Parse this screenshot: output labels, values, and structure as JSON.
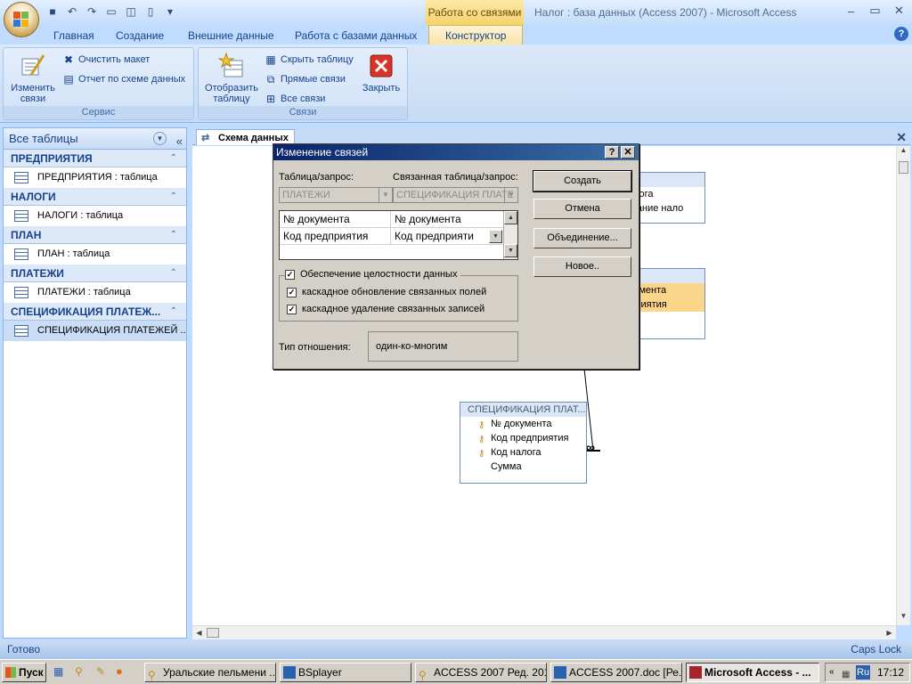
{
  "window": {
    "title": "Налог : база данных (Access 2007) - Microsoft Access",
    "context_tab_group": "Работа со связями"
  },
  "ribbon": {
    "tabs": [
      "Главная",
      "Создание",
      "Внешние данные",
      "Работа с базами данных"
    ],
    "active_tab": "Конструктор",
    "groups": {
      "service": {
        "label": "Сервис",
        "edit_relations": "Изменить связи",
        "clear_layout": "Очистить макет",
        "relation_report": "Отчет по схеме данных"
      },
      "relations": {
        "label": "Связи",
        "show_table": "Отобразить таблицу",
        "hide_table": "Скрыть таблицу",
        "direct_relations": "Прямые связи",
        "all_relations": "Все связи",
        "close": "Закрыть"
      }
    }
  },
  "nav": {
    "title": "Все таблицы",
    "groups": [
      {
        "name": "ПРЕДПРИЯТИЯ",
        "item": "ПРЕДПРИЯТИЯ : таблица"
      },
      {
        "name": "НАЛОГИ",
        "item": "НАЛОГИ : таблица"
      },
      {
        "name": "ПЛАН",
        "item": "ПЛАН : таблица"
      },
      {
        "name": "ПЛАТЕЖИ",
        "item": "ПЛАТЕЖИ : таблица"
      },
      {
        "name": "СПЕЦИФИКАЦИЯ ПЛАТЕЖ...",
        "item": "СПЕЦИФИКАЦИЯ ПЛАТЕЖЕЙ ..."
      }
    ]
  },
  "document": {
    "tab": "Схема данных"
  },
  "diagram": {
    "tables": [
      {
        "title": "",
        "fields": [
          "лога",
          "нование нало"
        ]
      },
      {
        "title": "",
        "fields": [
          "кумента",
          "дприятия"
        ]
      },
      {
        "title": "СПЕЦИФИКАЦИЯ ПЛАТ...",
        "fields": [
          "№ документа",
          "Код предприятия",
          "Код налога",
          "Сумма"
        ]
      }
    ],
    "relation_symbol": "∞"
  },
  "dialog": {
    "title": "Изменение связей",
    "help_btn": "?",
    "close_btn": "✕",
    "table_label": "Таблица/запрос:",
    "related_label": "Связанная таблица/запрос:",
    "table_value": "ПЛАТЕЖИ",
    "related_value": "СПЕЦИФИКАЦИЯ ПЛАТЕ",
    "rows": [
      {
        "left": "№ документа",
        "right": "№ документа"
      },
      {
        "left": "Код предприятия",
        "right": "Код предприяти"
      }
    ],
    "integrity": "Обеспечение целостности данных",
    "cascade_update": "каскадное обновление связанных полей",
    "cascade_delete": "каскадное удаление связанных записей",
    "reltype_label": "Тип отношения:",
    "reltype_value": "один-ко-многим",
    "buttons": {
      "create": "Создать",
      "cancel": "Отмена",
      "join": "Объединение...",
      "new": "Новое.."
    }
  },
  "status": {
    "left": "Готово",
    "right": "Caps Lock"
  },
  "taskbar": {
    "start": "Пуск",
    "tasks": [
      "Уральские пельмени ...",
      "BSplayer",
      "ACCESS 2007 Ред. 2012",
      "ACCESS 2007.doc [Ре...",
      "Microsoft Access - ..."
    ],
    "lang": "Ru",
    "time": "17:12"
  }
}
